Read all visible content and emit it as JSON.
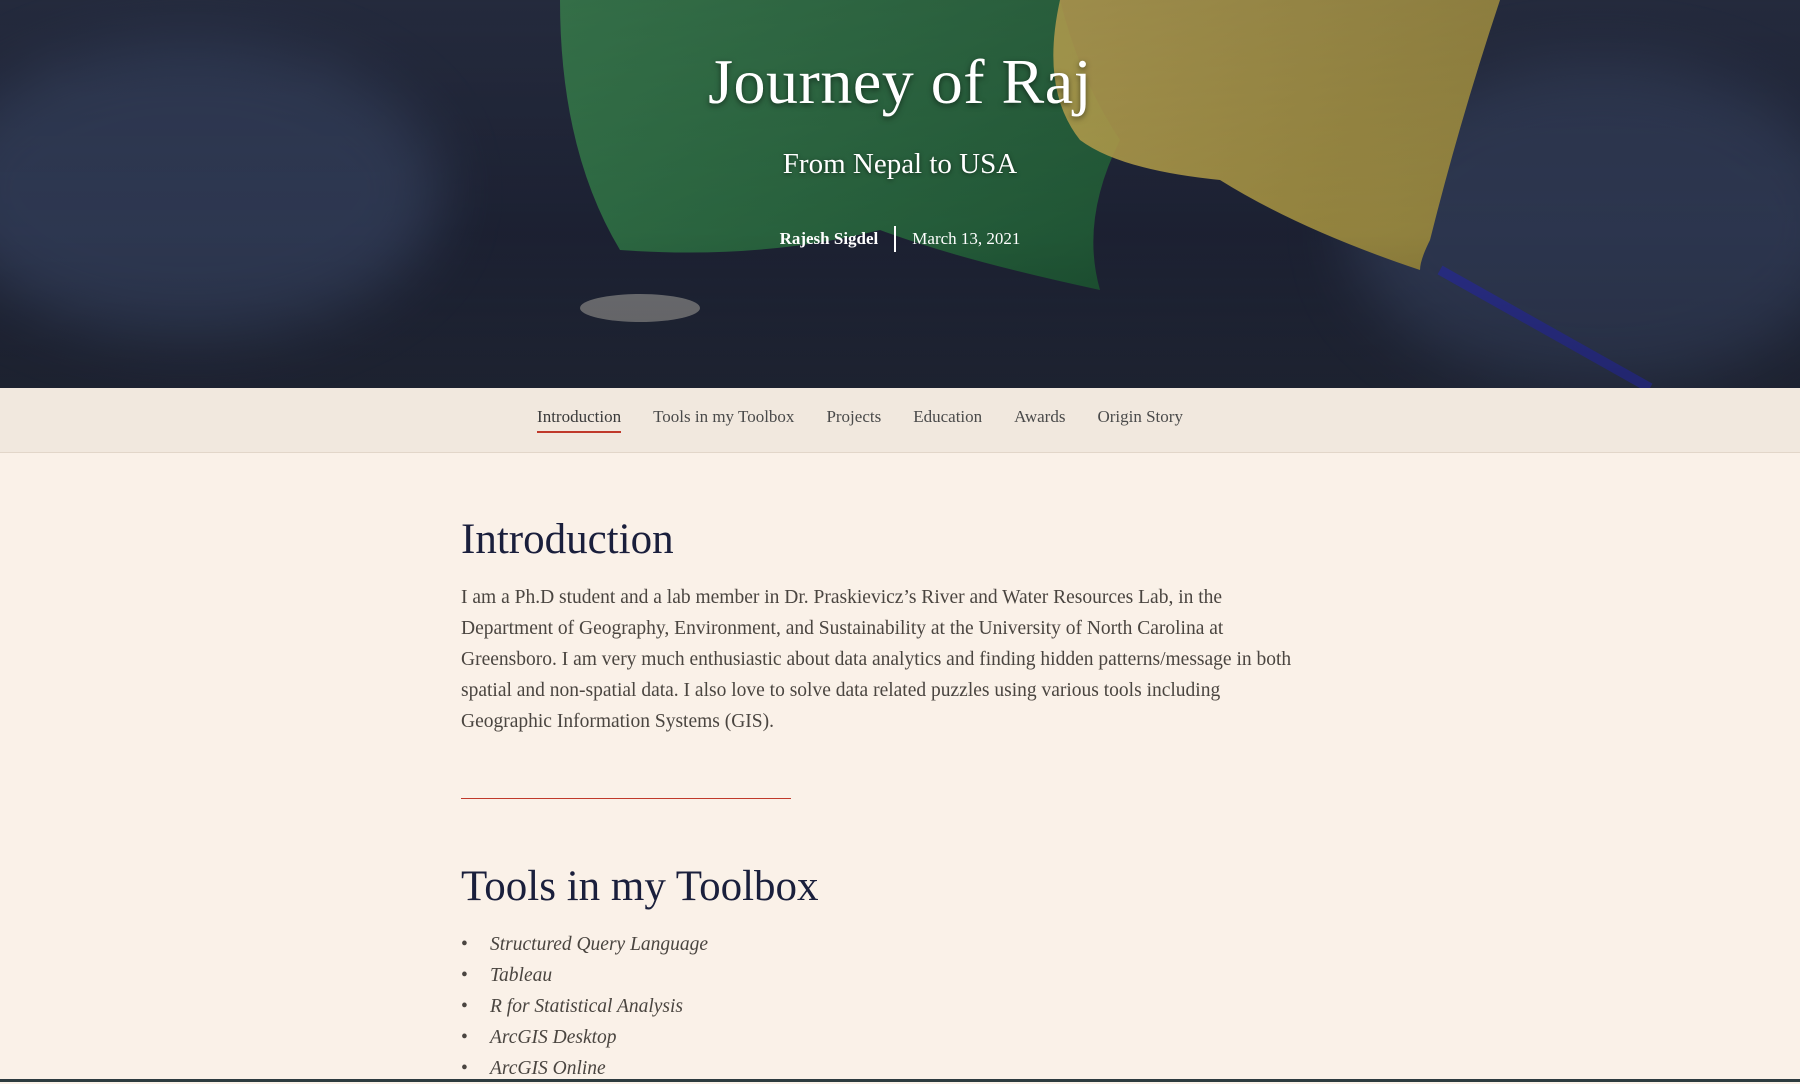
{
  "hero": {
    "title": "Journey of Raj",
    "subtitle": "From Nepal to USA",
    "author": "Rajesh Sigdel",
    "date": "March 13, 2021"
  },
  "nav": {
    "items": [
      {
        "label": "Introduction",
        "active": true
      },
      {
        "label": "Tools in my Toolbox",
        "active": false
      },
      {
        "label": "Projects",
        "active": false
      },
      {
        "label": "Education",
        "active": false
      },
      {
        "label": "Awards",
        "active": false
      },
      {
        "label": "Origin Story",
        "active": false
      }
    ]
  },
  "intro": {
    "title": "Introduction",
    "body": "I am a Ph.D student and a lab member in Dr.  Praskievicz’s River and Water Resources Lab, in the Department of Geography, Environment, and Sustainability at the University of North Carolina at Greensboro. I am very much enthusiastic about data analytics and finding hidden patterns/message in both spatial and non-spatial data. I also love to solve data related puzzles using various tools including Geographic Information Systems (GIS)."
  },
  "tools": {
    "title": "Tools in my Toolbox",
    "items": [
      "Structured Query Language",
      "Tableau",
      "R for Statistical Analysis",
      "ArcGIS Desktop",
      "ArcGIS Online"
    ]
  },
  "colors": {
    "accent": "#c0392b",
    "heading": "#1a1f3c",
    "body_text": "#4a4540",
    "page_bg": "#faf1e8",
    "nav_bg": "#f1e8de"
  }
}
